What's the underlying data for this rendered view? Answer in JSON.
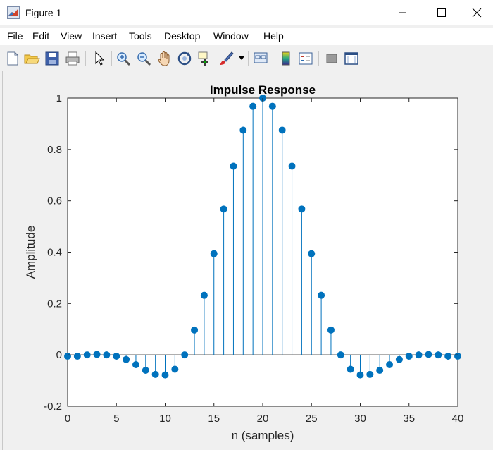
{
  "window": {
    "title": "Figure 1",
    "minimize_icon": "minimize-icon",
    "maximize_icon": "maximize-icon",
    "close_icon": "close-icon"
  },
  "menu": [
    "File",
    "Edit",
    "View",
    "Insert",
    "Tools",
    "Desktop",
    "Window",
    "Help"
  ],
  "toolbar": {
    "icons": [
      "new-figure-icon",
      "open-file-icon",
      "save-icon",
      "print-icon",
      "select-arrow-icon",
      "zoom-in-icon",
      "zoom-out-icon",
      "pan-hand-icon",
      "rotate-3d-icon",
      "data-cursor-icon",
      "brush-icon",
      "link-plot-icon",
      "colorbar-icon",
      "legend-icon",
      "hide-plot-tools-icon",
      "show-plot-tools-icon"
    ]
  },
  "colors": {
    "stem": "#0072bd",
    "axes_bg": "#ffffff",
    "figure_bg": "#f0f0f0"
  },
  "chart_data": {
    "type": "stem",
    "title": "Impulse Response",
    "xlabel": "n (samples)",
    "ylabel": "Amplitude",
    "xlim": [
      0,
      40
    ],
    "ylim": [
      -0.2,
      1
    ],
    "xticks": [
      0,
      5,
      10,
      15,
      20,
      25,
      30,
      35,
      40
    ],
    "xtick_labels": [
      "0",
      "5",
      "10",
      "15",
      "20",
      "25",
      "30",
      "35",
      "40"
    ],
    "yticks": [
      -0.2,
      0,
      0.2,
      0.4,
      0.6,
      0.8,
      1
    ],
    "ytick_labels": [
      "-0.2",
      "0",
      "0.2",
      "0.4",
      "0.6",
      "0.8",
      "1"
    ],
    "grid": false,
    "series": [
      {
        "x": [
          0,
          1,
          2,
          3,
          4,
          5,
          6,
          7,
          8,
          9,
          10,
          11,
          12,
          13,
          14,
          15,
          16,
          17,
          18,
          19,
          20,
          21,
          22,
          23,
          24,
          25,
          26,
          27,
          28,
          29,
          30,
          31,
          32,
          33,
          34,
          35,
          36,
          37,
          38,
          39,
          40
        ],
        "y": [
          -0.005,
          -0.005,
          0.0,
          0.002,
          0.0,
          -0.005,
          -0.018,
          -0.038,
          -0.06,
          -0.076,
          -0.078,
          -0.056,
          0.0,
          0.097,
          0.232,
          0.394,
          0.568,
          0.735,
          0.875,
          0.968,
          1.0,
          0.968,
          0.875,
          0.735,
          0.568,
          0.394,
          0.232,
          0.097,
          0.0,
          -0.056,
          -0.078,
          -0.076,
          -0.06,
          -0.038,
          -0.018,
          -0.005,
          0.0,
          0.002,
          0.0,
          -0.005,
          -0.005
        ]
      }
    ]
  }
}
